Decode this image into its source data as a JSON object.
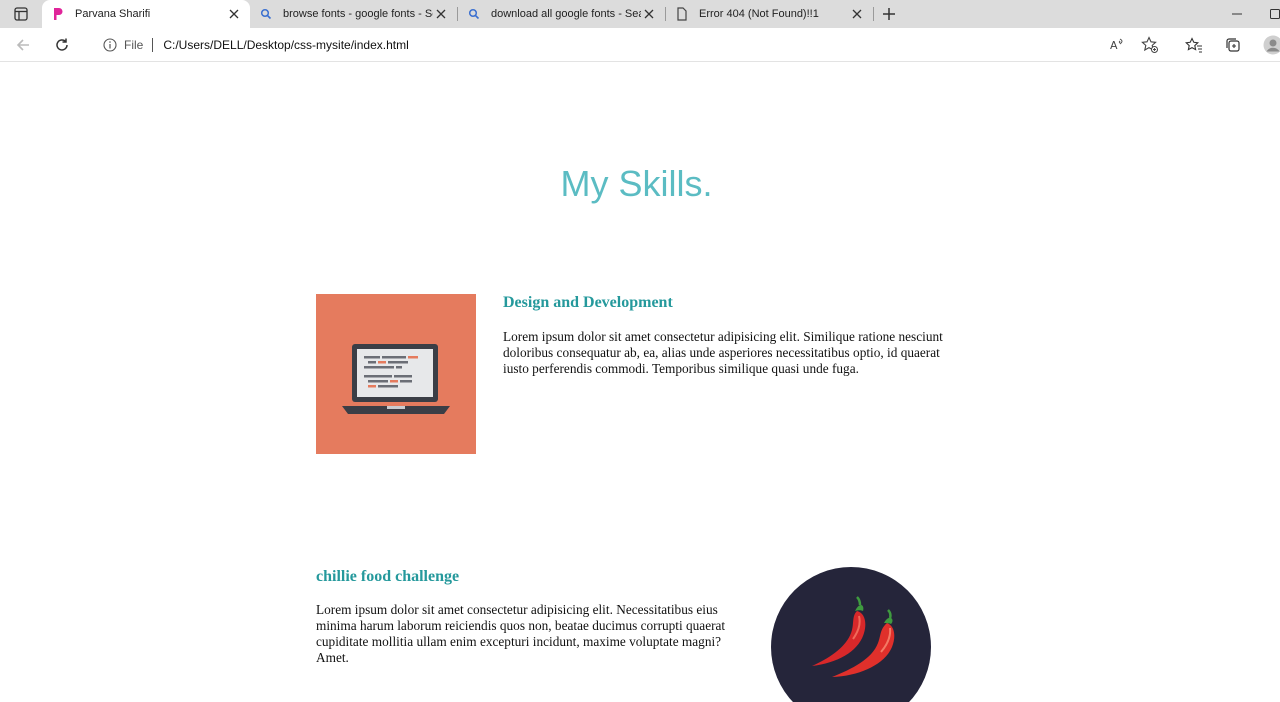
{
  "browser": {
    "tabs": [
      {
        "title": "Parvana Sharifi",
        "active": true,
        "favicon": "page-p-icon"
      },
      {
        "title": "browse fonts - google fonts - Se",
        "active": false,
        "favicon": "search-icon"
      },
      {
        "title": "download all google fonts - Sear",
        "active": false,
        "favicon": "search-icon"
      },
      {
        "title": "Error 404 (Not Found)!!1",
        "active": false,
        "favicon": "document-icon"
      }
    ],
    "address": {
      "scheme_label": "File",
      "url": "C:/Users/DELL/Desktop/css-mysite/index.html"
    },
    "accent_color": "#5bbcc3"
  },
  "page": {
    "title": "My Skills.",
    "skills": [
      {
        "heading": "Design and Development",
        "text": "Lorem ipsum dolor sit amet consectetur adipisicing elit. Similique ratione nesciunt doloribus consequatur ab, ea, alias unde asperiores necessitatibus optio, id quaerat iusto perferendis commodi. Temporibus similique quasi unde fuga.",
        "image_icon": "laptop-icon",
        "image_bg": "#e57b5e"
      },
      {
        "heading": "chillie food challenge",
        "text": "Lorem ipsum dolor sit amet consectetur adipisicing elit. Necessitatibus eius minima harum laborum reiciendis quos non, beatae ducimus corrupti quaerat cupiditate mollitia ullam enim excepturi incidunt, maxime voluptate magni? Amet.",
        "image_icon": "chili-pepper-icon",
        "image_bg": "#25253a"
      }
    ]
  }
}
